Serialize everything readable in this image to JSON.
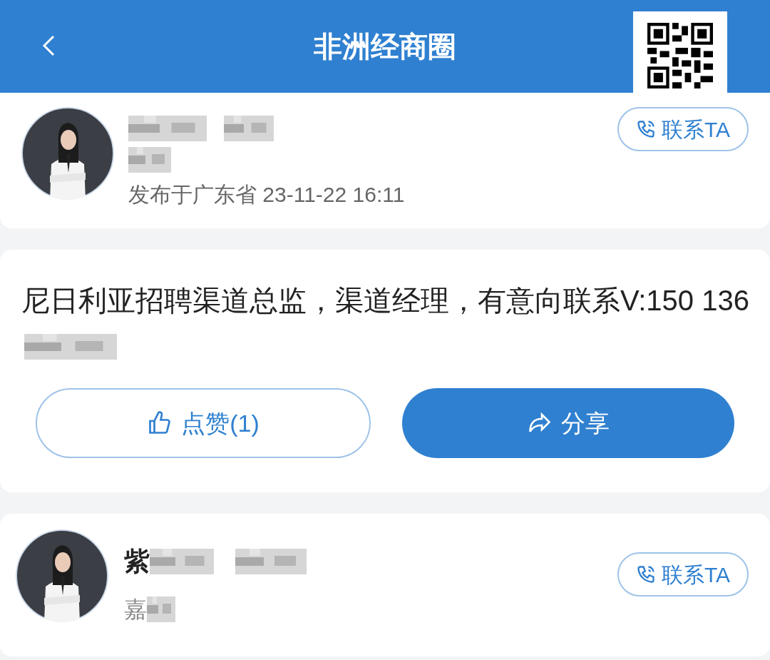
{
  "header": {
    "title": "非洲经商圈"
  },
  "author_card": {
    "location_time": "发布于广东省 23-11-22 16:11",
    "contact_button": "联系TA"
  },
  "post": {
    "text": "尼日利亚招聘渠道总监，渠道经理，有意向联系V:150 136",
    "like_button": "点赞(1)",
    "share_button": "分享"
  },
  "next_author": {
    "name_start": "紫",
    "company_start": "嘉",
    "contact_button": "联系TA"
  }
}
